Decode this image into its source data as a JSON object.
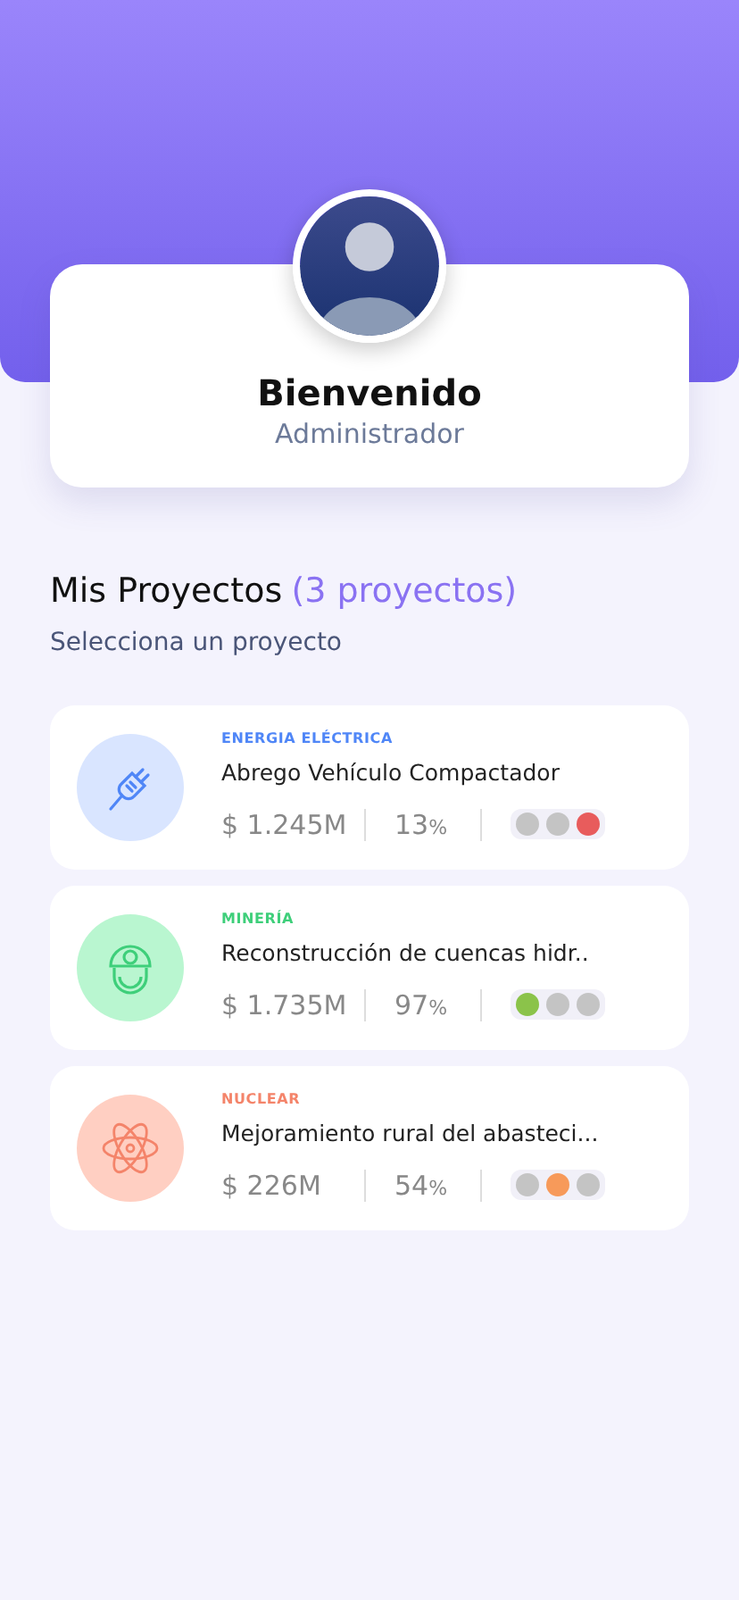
{
  "profile": {
    "greeting": "Bienvenido",
    "role": "Administrador"
  },
  "section": {
    "title": "Mis Proyectos",
    "count": "(3 proyectos)",
    "subtitle": "Selecciona un proyecto"
  },
  "projects": [
    {
      "kind": "electric",
      "category": "ENERGIA ELÉCTRICA",
      "color": "#4f86f7",
      "name": "Abrego Vehículo Compactador",
      "amount": "$ 1.245M",
      "progress": "13",
      "unit": "%",
      "dots": [
        {
          "color": "#c4c4c4"
        },
        {
          "color": "#c4c4c4"
        },
        {
          "color": "#e85c5c"
        }
      ]
    },
    {
      "kind": "mining",
      "category": "MINERÍA",
      "color": "#3ecf7a",
      "name": "Reconstrucción de cuencas hidr..",
      "amount": "$ 1.735M",
      "progress": "97",
      "unit": "%",
      "dots": [
        {
          "color": "#8bc34a"
        },
        {
          "color": "#c4c4c4"
        },
        {
          "color": "#c4c4c4"
        }
      ]
    },
    {
      "kind": "nuclear",
      "category": "NUCLEAR",
      "color": "#f4846a",
      "name": "Mejoramiento rural del abasteci...",
      "amount": "$ 226M",
      "progress": "54",
      "unit": "%",
      "dots": [
        {
          "color": "#c4c4c4"
        },
        {
          "color": "#f79a5a"
        },
        {
          "color": "#c4c4c4"
        }
      ]
    }
  ]
}
